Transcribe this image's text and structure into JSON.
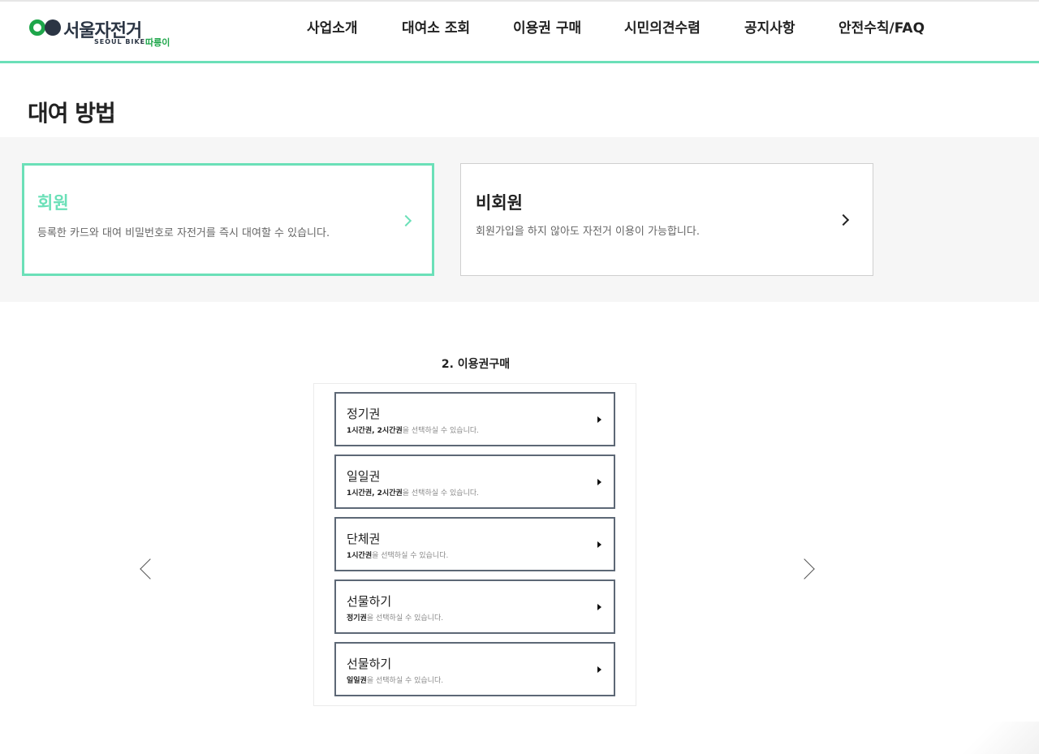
{
  "logo": {
    "main": "서울자전거",
    "sub": "SEOUL BIKE",
    "sub2": "따릉이"
  },
  "nav": {
    "items": [
      {
        "label": "사업소개"
      },
      {
        "label": "대여소 조회"
      },
      {
        "label": "이용권 구매"
      },
      {
        "label": "시민의견수렴"
      },
      {
        "label": "공지사항"
      },
      {
        "label": "안전수칙/FAQ"
      }
    ]
  },
  "page": {
    "title": "대여 방법"
  },
  "cards": {
    "member": {
      "title": "회원",
      "desc": "등록한 카드와 대여 비밀번호로 자전거를 즉시 대여할 수 있습니다."
    },
    "nonmember": {
      "title": "비회원",
      "desc": "회원가입을 하지 않아도 자전거 이용이 가능합니다."
    }
  },
  "section": {
    "title": "2. 이용권구매"
  },
  "tickets": [
    {
      "title": "정기권",
      "highlight": "1시간권, 2시간권",
      "rest": "을 선택하실 수 있습니다."
    },
    {
      "title": "일일권",
      "highlight": "1시간권, 2시간권",
      "rest": "을 선택하실 수 있습니다."
    },
    {
      "title": "단체권",
      "highlight": "1시간권",
      "rest": "을 선택하실 수 있습니다."
    },
    {
      "title": "선물하기",
      "highlight": "정기권",
      "rest": "을 선택하실 수 있습니다."
    },
    {
      "title": "선물하기",
      "highlight": "일일권",
      "rest": "을 선택하실 수 있습니다."
    }
  ],
  "colors": {
    "accent": "#6be0b8",
    "brand_green": "#1ea64a",
    "brand_dark": "#2b3544",
    "ticket_border": "#5d6876"
  },
  "icons": {
    "card_arrow": "chevron-right-icon",
    "ticket_arrow": "triangle-right-icon",
    "carousel_prev": "chevron-left-icon",
    "carousel_next": "chevron-right-icon"
  }
}
